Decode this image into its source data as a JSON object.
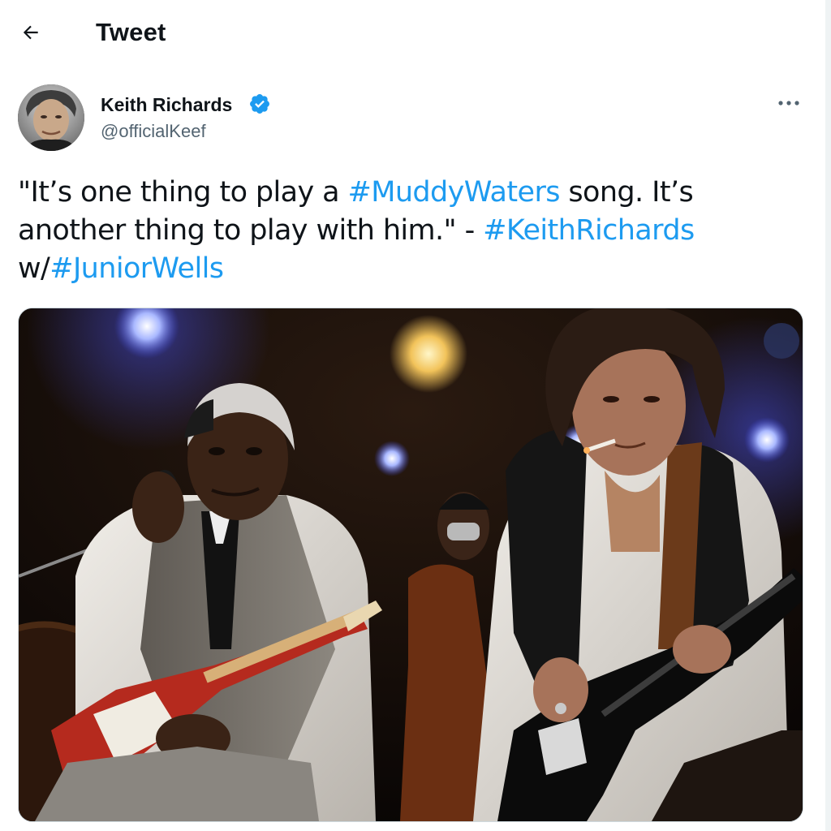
{
  "header": {
    "title": "Tweet",
    "back_icon": "arrow-left-icon"
  },
  "tweet": {
    "author": {
      "display_name": "Keith Richards",
      "handle": "@officialKeef",
      "verified": true,
      "verified_color": "#1d9bf0"
    },
    "more_icon": "more-horizontal-icon",
    "text_parts": {
      "p1": "\"It’s one thing to play a ",
      "tag1": "#MuddyWaters",
      "p2": " song. It’s another thing to play with him.\" - ",
      "tag2": "#KeithRichards",
      "p3": " w/",
      "tag3": "#JuniorWells"
    },
    "media": {
      "type": "photo"
    }
  },
  "colors": {
    "accent": "#1d9bf0",
    "text": "#0f1419",
    "secondary_text": "#536471"
  }
}
